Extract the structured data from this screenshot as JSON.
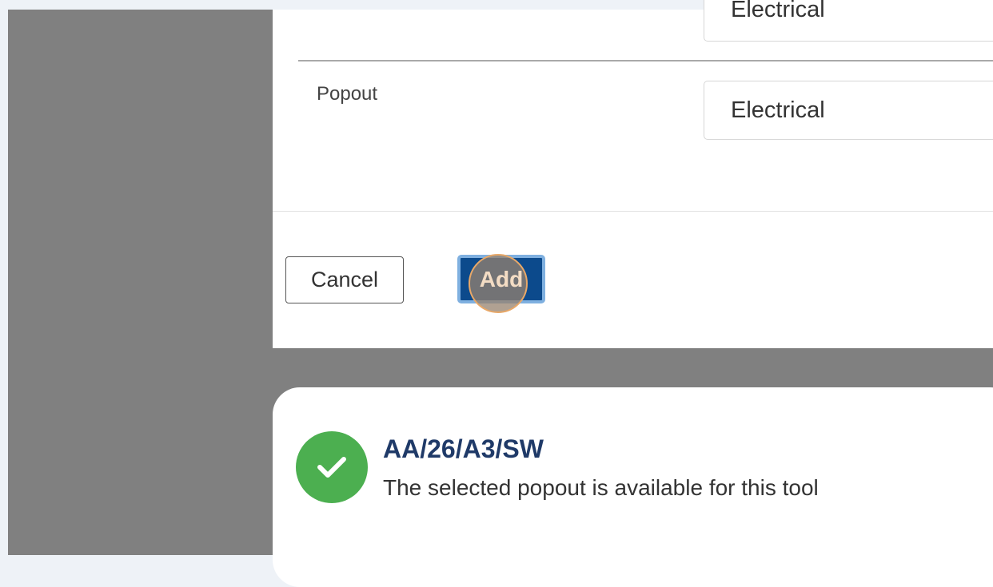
{
  "form": {
    "previous_select_value": "Electrical",
    "popout_label": "Popout",
    "popout_value": "Electrical"
  },
  "actions": {
    "cancel_label": "Cancel",
    "add_label": "Add"
  },
  "toast": {
    "title": "AA/26/A3/SW",
    "message": "The selected popout is available for this tool",
    "status": "success",
    "status_color": "#4caf50",
    "icon": "check-icon"
  },
  "colors": {
    "primary_button": "#0c4a8c",
    "title_text": "#1f3a68",
    "overlay": "#808080"
  }
}
